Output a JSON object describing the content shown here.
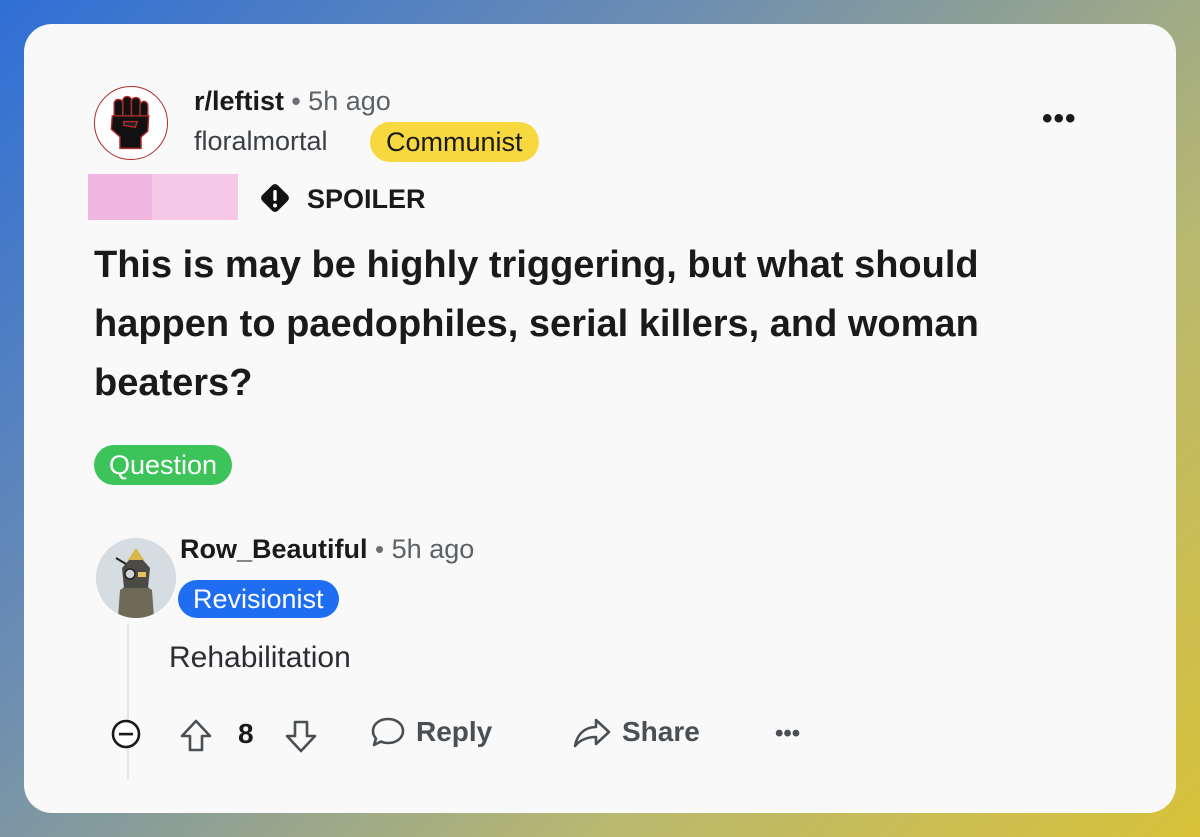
{
  "post": {
    "subreddit": "r/leftist",
    "separator": "•",
    "time": "5h ago",
    "author": "floralmortal",
    "author_flair": "Communist",
    "spoiler_label": "SPOILER",
    "title": "This is may be highly triggering, but what should happen to paedophiles, serial killers, and woman beaters?",
    "post_flair": "Question",
    "more_label": "•••"
  },
  "comment": {
    "author": "Row_Beautiful",
    "separator": "•",
    "time": "5h ago",
    "flair": "Revisionist",
    "body": "Rehabilitation",
    "vote_count": "8",
    "reply_label": "Reply",
    "share_label": "Share",
    "more_label": "•••"
  },
  "colors": {
    "author_flair_bg": "#f7d83e",
    "post_flair_bg": "#3cc35a",
    "comment_flair_bg": "#1f6ef2"
  },
  "icons": [
    "raised-fist-icon",
    "spoiler-warning-icon",
    "more-icon",
    "collapse-icon",
    "upvote-icon",
    "downvote-icon",
    "reply-icon",
    "share-icon"
  ]
}
